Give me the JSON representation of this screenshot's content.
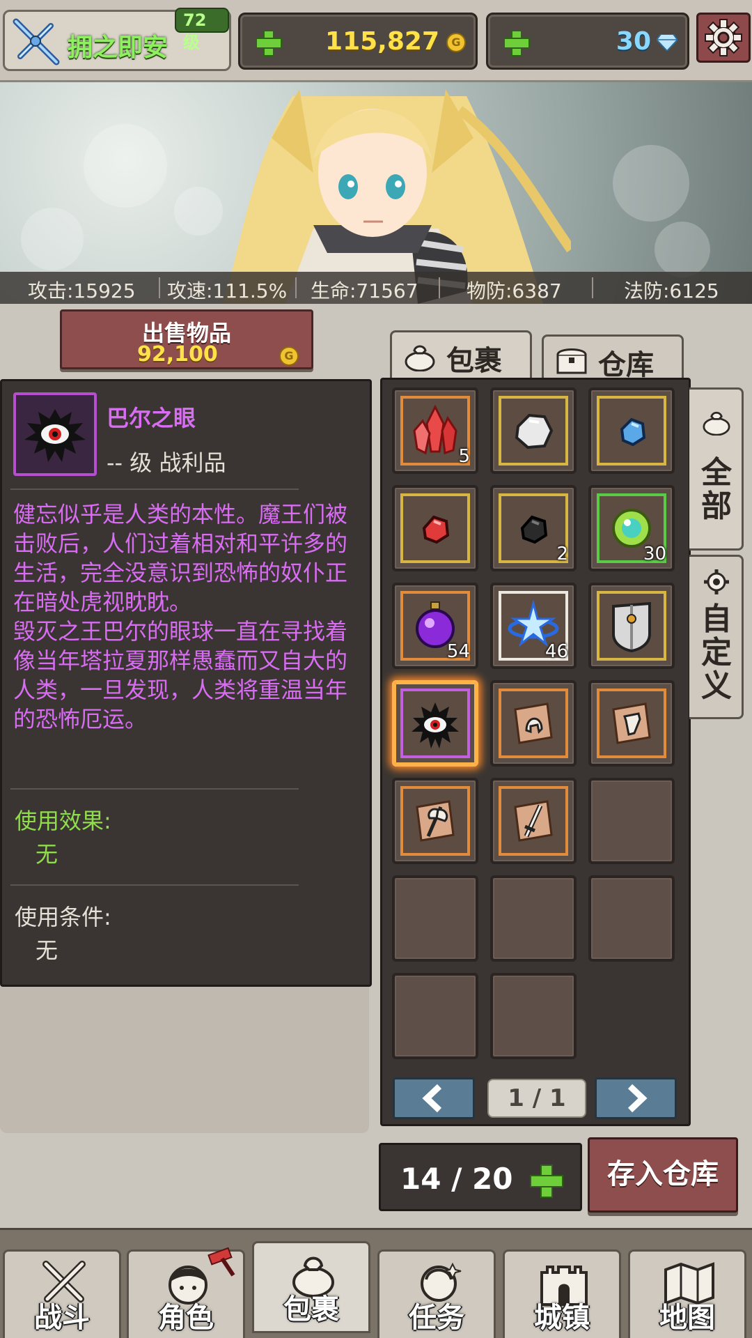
{
  "player": {
    "name": "拥之即安",
    "level": "72 级"
  },
  "currency": {
    "gold": "115,827",
    "coin_symbol": "G",
    "gems": "30"
  },
  "stats": [
    {
      "label": "攻击:15925"
    },
    {
      "label": "攻速:111.5%"
    },
    {
      "label": "生命:71567"
    },
    {
      "label": "物防:6387"
    },
    {
      "label": "法防:6125"
    }
  ],
  "sell": {
    "label": "出售物品",
    "price": "92,100"
  },
  "item": {
    "name": "巴尔之眼",
    "subtitle": "-- 级 战利品",
    "desc_1": "健忘似乎是人类的本性。魔王们被击败后，人们过着相对和平许多的生活，完全没意识到恐怖的奴仆正在暗处虎视眈眈。",
    "desc_2": "毁灭之王巴尔的眼球一直在寻找着像当年塔拉夏那样愚蠢而又自大的人类，一旦发现，人类将重温当年的恐怖厄运。",
    "effect_heading": "使用效果:",
    "effect_value": "无",
    "condition_heading": "使用条件:",
    "condition_value": "无"
  },
  "tabs": {
    "bag": "包裹",
    "storage": "仓库"
  },
  "side_tabs": {
    "all": "全部",
    "custom": "自定义"
  },
  "inventory": {
    "slots": [
      {
        "icon": "red-crystal-icon",
        "rarity": "orange",
        "count": "5"
      },
      {
        "icon": "white-ore-icon",
        "rarity": "gold",
        "count": ""
      },
      {
        "icon": "blue-ore-icon",
        "rarity": "gold",
        "count": ""
      },
      {
        "icon": "red-ore-icon",
        "rarity": "gold",
        "count": ""
      },
      {
        "icon": "black-ore-icon",
        "rarity": "gold",
        "count": "2"
      },
      {
        "icon": "green-orb-icon",
        "rarity": "green",
        "count": "30"
      },
      {
        "icon": "purple-orb-icon",
        "rarity": "orange",
        "count": "54"
      },
      {
        "icon": "ice-crystal-icon",
        "rarity": "white",
        "count": "46"
      },
      {
        "icon": "shield-icon",
        "rarity": "gold",
        "count": ""
      },
      {
        "icon": "eye-of-baal-icon",
        "rarity": "purple",
        "count": "",
        "selected": true
      },
      {
        "icon": "helmet-scroll-icon",
        "rarity": "orange",
        "count": ""
      },
      {
        "icon": "armor-scroll-icon",
        "rarity": "orange",
        "count": ""
      },
      {
        "icon": "axe-scroll-icon",
        "rarity": "orange",
        "count": ""
      },
      {
        "icon": "sword-scroll-icon",
        "rarity": "orange",
        "count": ""
      }
    ],
    "page": "1 / 1",
    "capacity": "14 / 20"
  },
  "deposit_label": "存入仓库",
  "nav": [
    {
      "label": "战斗",
      "icon": "crossed-swords-icon"
    },
    {
      "label": "角色",
      "icon": "character-face-icon"
    },
    {
      "label": "包裹",
      "icon": "bag-icon"
    },
    {
      "label": "任务",
      "icon": "quest-icon"
    },
    {
      "label": "城镇",
      "icon": "castle-icon"
    },
    {
      "label": "地图",
      "icon": "map-icon"
    }
  ],
  "colors": {
    "accent_red": "#8f4e4e",
    "item_name_purple": "#d86cf2",
    "effect_green": "#8fdc4d",
    "gold_text": "#ffe14a"
  }
}
